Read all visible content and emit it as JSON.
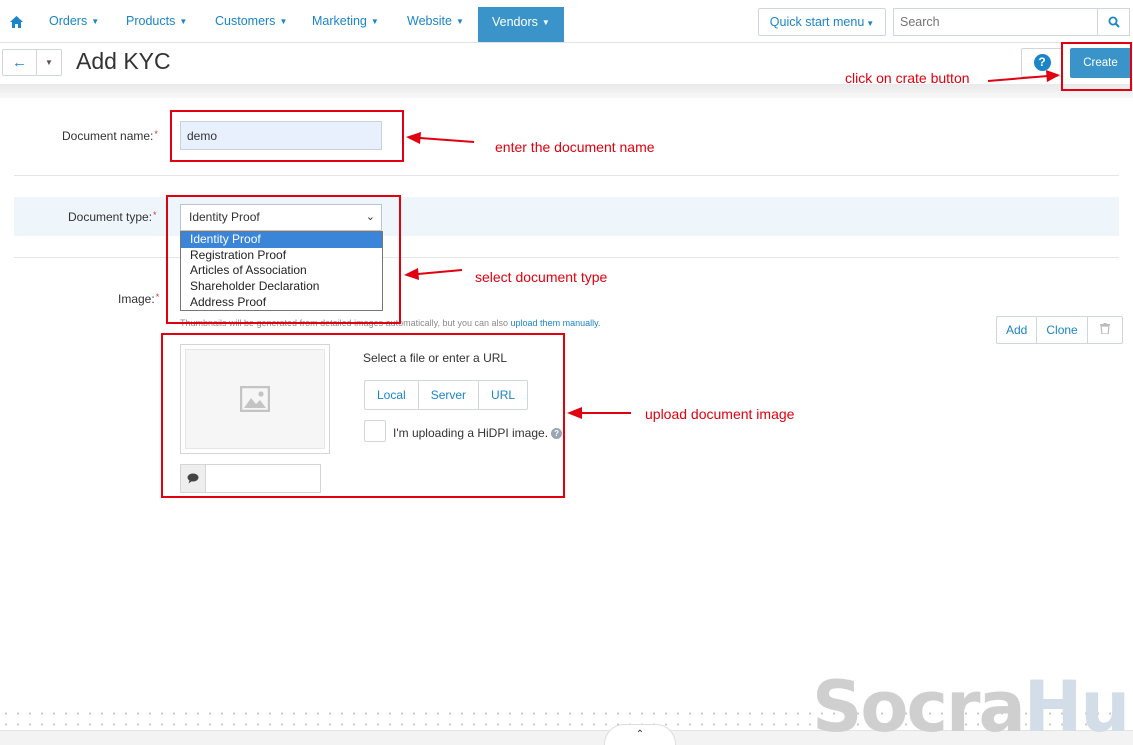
{
  "nav": {
    "items": [
      {
        "label": "Orders"
      },
      {
        "label": "Products"
      },
      {
        "label": "Customers"
      },
      {
        "label": "Marketing"
      },
      {
        "label": "Website"
      },
      {
        "label": "Vendors"
      }
    ],
    "active_item": "Vendors",
    "quick_start": "Quick start menu",
    "search_placeholder": "Search"
  },
  "header": {
    "title": "Add KYC",
    "create_label": "Create"
  },
  "form": {
    "doc_name_label": "Document name:",
    "doc_name_value": "demo",
    "doc_type_label": "Document type:",
    "doc_type_selected": "Identity Proof",
    "doc_type_options": [
      "Identity Proof",
      "Registration Proof",
      "Articles of Association",
      "Shareholder Declaration",
      "Address Proof"
    ],
    "image_label": "Image:",
    "hint_text": "Thumbnails will be generated from detailed images automatically, but you can also",
    "hint_link": "upload them manually.",
    "add_label": "Add",
    "clone_label": "Clone",
    "source_title": "Select a file or enter a URL",
    "sources": [
      "Local",
      "Server",
      "URL"
    ],
    "hidpi_label": "I'm uploading a HiDPI image."
  },
  "annotations": {
    "create": "click on crate button",
    "name": "enter the document name",
    "type": "select document type",
    "image": "upload document image"
  },
  "watermark": {
    "part1": "Socra",
    "part2": "Hub"
  },
  "colors": {
    "accent": "#1a85c8",
    "primary_button": "#3a94c9",
    "annotation": "#e0000f"
  }
}
